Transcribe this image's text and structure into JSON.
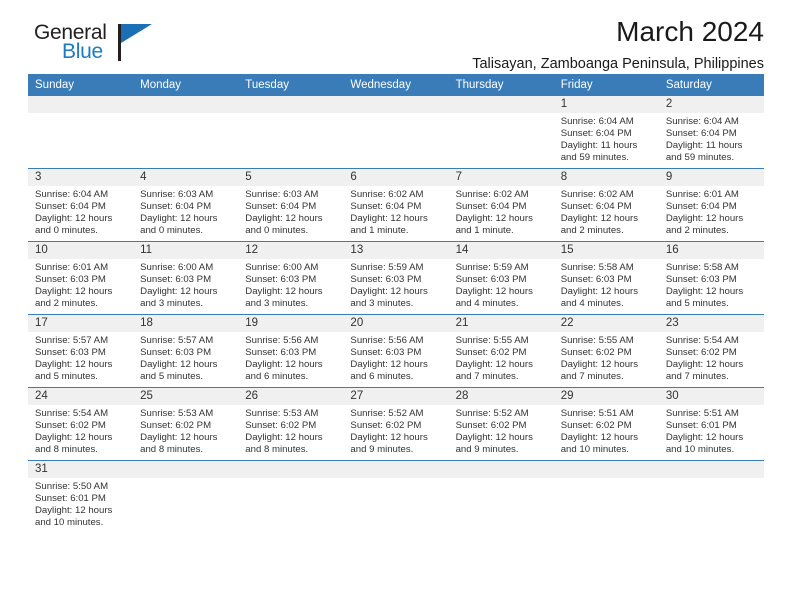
{
  "brand": {
    "name_dark": "General",
    "name_light": "Blue",
    "flag_icon": "triangle-flag-icon",
    "accent_color": "#1b7bc4"
  },
  "header": {
    "title": "March 2024",
    "subtitle": "Talisayan, Zamboanga Peninsula, Philippines"
  },
  "theme": {
    "header_blue": "#3a7cb8",
    "band_gray": "#f0f0f0",
    "text_color": "#333333"
  },
  "weekdays": [
    "Sunday",
    "Monday",
    "Tuesday",
    "Wednesday",
    "Thursday",
    "Friday",
    "Saturday"
  ],
  "labels": {
    "sunrise_prefix": "Sunrise:",
    "sunset_prefix": "Sunset:",
    "daylight_prefix": "Daylight:"
  },
  "weeks": [
    [
      {
        "day": ""
      },
      {
        "day": ""
      },
      {
        "day": ""
      },
      {
        "day": ""
      },
      {
        "day": ""
      },
      {
        "day": "1",
        "sunrise": "Sunrise: 6:04 AM",
        "sunset": "Sunset: 6:04 PM",
        "daylight_line1": "Daylight: 11 hours",
        "daylight_line2": "and 59 minutes."
      },
      {
        "day": "2",
        "sunrise": "Sunrise: 6:04 AM",
        "sunset": "Sunset: 6:04 PM",
        "daylight_line1": "Daylight: 11 hours",
        "daylight_line2": "and 59 minutes."
      }
    ],
    [
      {
        "day": "3",
        "sunrise": "Sunrise: 6:04 AM",
        "sunset": "Sunset: 6:04 PM",
        "daylight_line1": "Daylight: 12 hours",
        "daylight_line2": "and 0 minutes."
      },
      {
        "day": "4",
        "sunrise": "Sunrise: 6:03 AM",
        "sunset": "Sunset: 6:04 PM",
        "daylight_line1": "Daylight: 12 hours",
        "daylight_line2": "and 0 minutes."
      },
      {
        "day": "5",
        "sunrise": "Sunrise: 6:03 AM",
        "sunset": "Sunset: 6:04 PM",
        "daylight_line1": "Daylight: 12 hours",
        "daylight_line2": "and 0 minutes."
      },
      {
        "day": "6",
        "sunrise": "Sunrise: 6:02 AM",
        "sunset": "Sunset: 6:04 PM",
        "daylight_line1": "Daylight: 12 hours",
        "daylight_line2": "and 1 minute."
      },
      {
        "day": "7",
        "sunrise": "Sunrise: 6:02 AM",
        "sunset": "Sunset: 6:04 PM",
        "daylight_line1": "Daylight: 12 hours",
        "daylight_line2": "and 1 minute."
      },
      {
        "day": "8",
        "sunrise": "Sunrise: 6:02 AM",
        "sunset": "Sunset: 6:04 PM",
        "daylight_line1": "Daylight: 12 hours",
        "daylight_line2": "and 2 minutes."
      },
      {
        "day": "9",
        "sunrise": "Sunrise: 6:01 AM",
        "sunset": "Sunset: 6:04 PM",
        "daylight_line1": "Daylight: 12 hours",
        "daylight_line2": "and 2 minutes."
      }
    ],
    [
      {
        "day": "10",
        "sunrise": "Sunrise: 6:01 AM",
        "sunset": "Sunset: 6:03 PM",
        "daylight_line1": "Daylight: 12 hours",
        "daylight_line2": "and 2 minutes."
      },
      {
        "day": "11",
        "sunrise": "Sunrise: 6:00 AM",
        "sunset": "Sunset: 6:03 PM",
        "daylight_line1": "Daylight: 12 hours",
        "daylight_line2": "and 3 minutes."
      },
      {
        "day": "12",
        "sunrise": "Sunrise: 6:00 AM",
        "sunset": "Sunset: 6:03 PM",
        "daylight_line1": "Daylight: 12 hours",
        "daylight_line2": "and 3 minutes."
      },
      {
        "day": "13",
        "sunrise": "Sunrise: 5:59 AM",
        "sunset": "Sunset: 6:03 PM",
        "daylight_line1": "Daylight: 12 hours",
        "daylight_line2": "and 3 minutes."
      },
      {
        "day": "14",
        "sunrise": "Sunrise: 5:59 AM",
        "sunset": "Sunset: 6:03 PM",
        "daylight_line1": "Daylight: 12 hours",
        "daylight_line2": "and 4 minutes."
      },
      {
        "day": "15",
        "sunrise": "Sunrise: 5:58 AM",
        "sunset": "Sunset: 6:03 PM",
        "daylight_line1": "Daylight: 12 hours",
        "daylight_line2": "and 4 minutes."
      },
      {
        "day": "16",
        "sunrise": "Sunrise: 5:58 AM",
        "sunset": "Sunset: 6:03 PM",
        "daylight_line1": "Daylight: 12 hours",
        "daylight_line2": "and 5 minutes."
      }
    ],
    [
      {
        "day": "17",
        "sunrise": "Sunrise: 5:57 AM",
        "sunset": "Sunset: 6:03 PM",
        "daylight_line1": "Daylight: 12 hours",
        "daylight_line2": "and 5 minutes."
      },
      {
        "day": "18",
        "sunrise": "Sunrise: 5:57 AM",
        "sunset": "Sunset: 6:03 PM",
        "daylight_line1": "Daylight: 12 hours",
        "daylight_line2": "and 5 minutes."
      },
      {
        "day": "19",
        "sunrise": "Sunrise: 5:56 AM",
        "sunset": "Sunset: 6:03 PM",
        "daylight_line1": "Daylight: 12 hours",
        "daylight_line2": "and 6 minutes."
      },
      {
        "day": "20",
        "sunrise": "Sunrise: 5:56 AM",
        "sunset": "Sunset: 6:03 PM",
        "daylight_line1": "Daylight: 12 hours",
        "daylight_line2": "and 6 minutes."
      },
      {
        "day": "21",
        "sunrise": "Sunrise: 5:55 AM",
        "sunset": "Sunset: 6:02 PM",
        "daylight_line1": "Daylight: 12 hours",
        "daylight_line2": "and 7 minutes."
      },
      {
        "day": "22",
        "sunrise": "Sunrise: 5:55 AM",
        "sunset": "Sunset: 6:02 PM",
        "daylight_line1": "Daylight: 12 hours",
        "daylight_line2": "and 7 minutes."
      },
      {
        "day": "23",
        "sunrise": "Sunrise: 5:54 AM",
        "sunset": "Sunset: 6:02 PM",
        "daylight_line1": "Daylight: 12 hours",
        "daylight_line2": "and 7 minutes."
      }
    ],
    [
      {
        "day": "24",
        "sunrise": "Sunrise: 5:54 AM",
        "sunset": "Sunset: 6:02 PM",
        "daylight_line1": "Daylight: 12 hours",
        "daylight_line2": "and 8 minutes."
      },
      {
        "day": "25",
        "sunrise": "Sunrise: 5:53 AM",
        "sunset": "Sunset: 6:02 PM",
        "daylight_line1": "Daylight: 12 hours",
        "daylight_line2": "and 8 minutes."
      },
      {
        "day": "26",
        "sunrise": "Sunrise: 5:53 AM",
        "sunset": "Sunset: 6:02 PM",
        "daylight_line1": "Daylight: 12 hours",
        "daylight_line2": "and 8 minutes."
      },
      {
        "day": "27",
        "sunrise": "Sunrise: 5:52 AM",
        "sunset": "Sunset: 6:02 PM",
        "daylight_line1": "Daylight: 12 hours",
        "daylight_line2": "and 9 minutes."
      },
      {
        "day": "28",
        "sunrise": "Sunrise: 5:52 AM",
        "sunset": "Sunset: 6:02 PM",
        "daylight_line1": "Daylight: 12 hours",
        "daylight_line2": "and 9 minutes."
      },
      {
        "day": "29",
        "sunrise": "Sunrise: 5:51 AM",
        "sunset": "Sunset: 6:02 PM",
        "daylight_line1": "Daylight: 12 hours",
        "daylight_line2": "and 10 minutes."
      },
      {
        "day": "30",
        "sunrise": "Sunrise: 5:51 AM",
        "sunset": "Sunset: 6:01 PM",
        "daylight_line1": "Daylight: 12 hours",
        "daylight_line2": "and 10 minutes."
      }
    ],
    [
      {
        "day": "31",
        "sunrise": "Sunrise: 5:50 AM",
        "sunset": "Sunset: 6:01 PM",
        "daylight_line1": "Daylight: 12 hours",
        "daylight_line2": "and 10 minutes."
      },
      {
        "day": ""
      },
      {
        "day": ""
      },
      {
        "day": ""
      },
      {
        "day": ""
      },
      {
        "day": ""
      },
      {
        "day": ""
      }
    ]
  ]
}
